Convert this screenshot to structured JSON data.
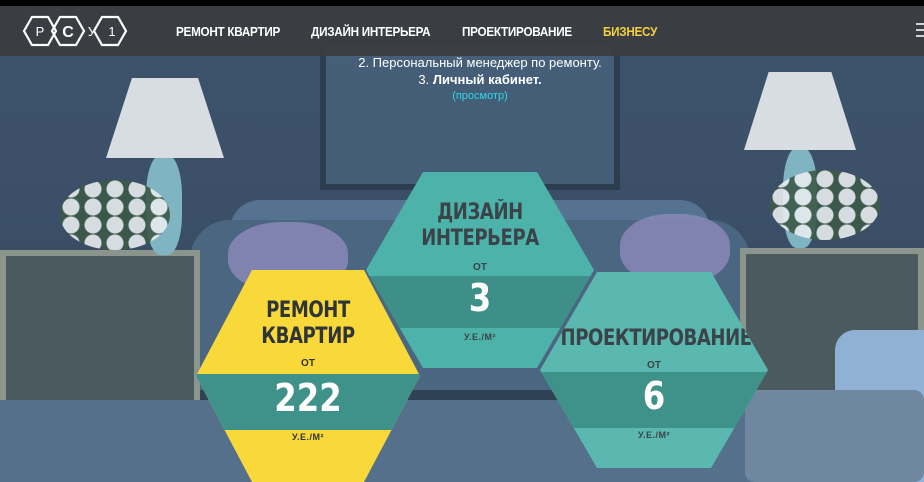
{
  "logo": {
    "letters": [
      "Р",
      "С",
      "У",
      "1"
    ]
  },
  "nav": {
    "items": [
      {
        "label": "РЕМОНТ КВАРТИР"
      },
      {
        "label": "ДИЗАЙН ИНТЕРЬЕРА"
      },
      {
        "label": "ПРОЕКТИРОВАНИЕ"
      },
      {
        "label": "БИЗНЕСУ"
      }
    ],
    "active_color": "#f4d03f"
  },
  "info": {
    "line2": "2. Персональный менеджер по ремонту.",
    "line3_prefix": "3. ",
    "line3_bold": "Личный кабинет.",
    "link": "(просмотр)"
  },
  "hexes": {
    "repair": {
      "title_1": "РЕМОНТ",
      "title_2": "КВАРТИР",
      "from": "ОТ",
      "value": "222",
      "unit": "У.Е./М²",
      "color": "#f9d839"
    },
    "design": {
      "title_1": "ДИЗАЙН",
      "title_2": "ИНТЕРЬЕРА",
      "from": "ОТ",
      "value": "3",
      "unit": "У.Е./М²",
      "color": "#4db3aa"
    },
    "project": {
      "title_1": "ПРОЕКТИРОВАНИЕ",
      "from": "ОТ",
      "value": "6",
      "unit": "У.Е./М²",
      "color": "#5ab8b0"
    }
  }
}
